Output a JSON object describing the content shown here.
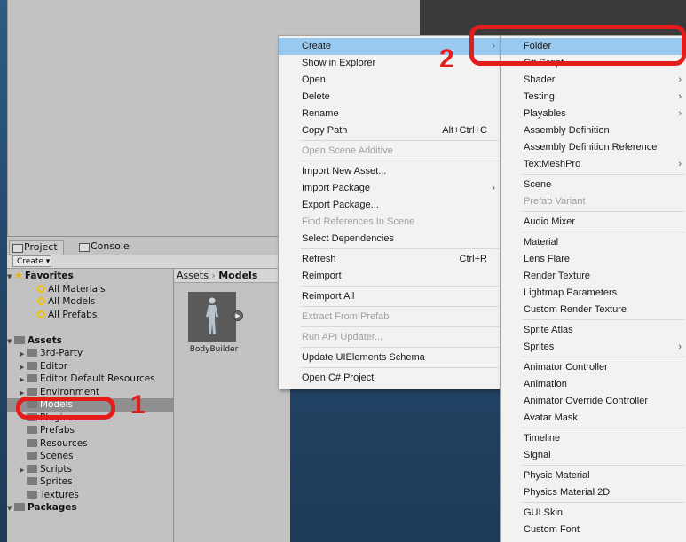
{
  "project_window": {
    "tabs": [
      {
        "label": "Project"
      },
      {
        "label": "Console"
      }
    ],
    "create_dropdown": "Create ▾",
    "tree": [
      {
        "label": "Favorites",
        "kind": "favorites",
        "bold": true
      },
      {
        "label": "All Materials",
        "kind": "search"
      },
      {
        "label": "All Models",
        "kind": "search"
      },
      {
        "label": "All Prefabs",
        "kind": "search"
      },
      {
        "label": "",
        "kind": "blank"
      },
      {
        "label": "Assets",
        "kind": "root",
        "bold": true
      },
      {
        "label": "3rd-Party",
        "kind": "folder",
        "expandable": true
      },
      {
        "label": "Editor",
        "kind": "folder",
        "expandable": true
      },
      {
        "label": "Editor Default Resources",
        "kind": "folder",
        "expandable": true
      },
      {
        "label": "Environment",
        "kind": "folder",
        "expandable": true
      },
      {
        "label": "Models",
        "kind": "folder",
        "selected": true
      },
      {
        "label": "Plugins",
        "kind": "folder"
      },
      {
        "label": "Prefabs",
        "kind": "folder"
      },
      {
        "label": "Resources",
        "kind": "folder"
      },
      {
        "label": "Scenes",
        "kind": "folder"
      },
      {
        "label": "Scripts",
        "kind": "folder",
        "expandable": true
      },
      {
        "label": "Sprites",
        "kind": "folder"
      },
      {
        "label": "Textures",
        "kind": "folder"
      },
      {
        "label": "Packages",
        "kind": "root",
        "bold": true
      }
    ],
    "breadcrumb": {
      "root": "Assets",
      "sep": "›",
      "current": "Models"
    },
    "asset": {
      "name": "BodyBuilder",
      "icon": "humanoid-model-icon"
    }
  },
  "context_menu": [
    {
      "label": "Create",
      "arrow": true,
      "highlighted": true
    },
    {
      "label": "Show in Explorer"
    },
    {
      "label": "Open"
    },
    {
      "label": "Delete"
    },
    {
      "label": "Rename"
    },
    {
      "label": "Copy Path",
      "shortcut": "Alt+Ctrl+C"
    },
    {
      "sep": true
    },
    {
      "label": "Open Scene Additive",
      "disabled": true
    },
    {
      "sep": true
    },
    {
      "label": "Import New Asset..."
    },
    {
      "label": "Import Package",
      "arrow": true
    },
    {
      "label": "Export Package..."
    },
    {
      "label": "Find References In Scene",
      "disabled": true
    },
    {
      "label": "Select Dependencies"
    },
    {
      "sep": true
    },
    {
      "label": "Refresh",
      "shortcut": "Ctrl+R"
    },
    {
      "label": "Reimport"
    },
    {
      "sep": true
    },
    {
      "label": "Reimport All"
    },
    {
      "sep": true
    },
    {
      "label": "Extract From Prefab",
      "disabled": true
    },
    {
      "sep": true
    },
    {
      "label": "Run API Updater...",
      "disabled": true
    },
    {
      "sep": true
    },
    {
      "label": "Update UIElements Schema"
    },
    {
      "sep": true
    },
    {
      "label": "Open C# Project"
    }
  ],
  "create_submenu": [
    {
      "label": "Folder",
      "highlighted": true
    },
    {
      "label": "C# Script"
    },
    {
      "label": "Shader",
      "arrow": true
    },
    {
      "label": "Testing",
      "arrow": true
    },
    {
      "label": "Playables",
      "arrow": true
    },
    {
      "label": "Assembly Definition"
    },
    {
      "label": "Assembly Definition Reference"
    },
    {
      "label": "TextMeshPro",
      "arrow": true
    },
    {
      "sep": true
    },
    {
      "label": "Scene"
    },
    {
      "label": "Prefab Variant",
      "disabled": true
    },
    {
      "sep": true
    },
    {
      "label": "Audio Mixer"
    },
    {
      "sep": true
    },
    {
      "label": "Material"
    },
    {
      "label": "Lens Flare"
    },
    {
      "label": "Render Texture"
    },
    {
      "label": "Lightmap Parameters"
    },
    {
      "label": "Custom Render Texture"
    },
    {
      "sep": true
    },
    {
      "label": "Sprite Atlas"
    },
    {
      "label": "Sprites",
      "arrow": true
    },
    {
      "sep": true
    },
    {
      "label": "Animator Controller"
    },
    {
      "label": "Animation"
    },
    {
      "label": "Animator Override Controller"
    },
    {
      "label": "Avatar Mask"
    },
    {
      "sep": true
    },
    {
      "label": "Timeline"
    },
    {
      "label": "Signal"
    },
    {
      "sep": true
    },
    {
      "label": "Physic Material"
    },
    {
      "label": "Physics Material 2D"
    },
    {
      "sep": true
    },
    {
      "label": "GUI Skin"
    },
    {
      "label": "Custom Font"
    }
  ],
  "annotations": {
    "step1": "1",
    "step2": "2",
    "color": "#e31c1c"
  }
}
